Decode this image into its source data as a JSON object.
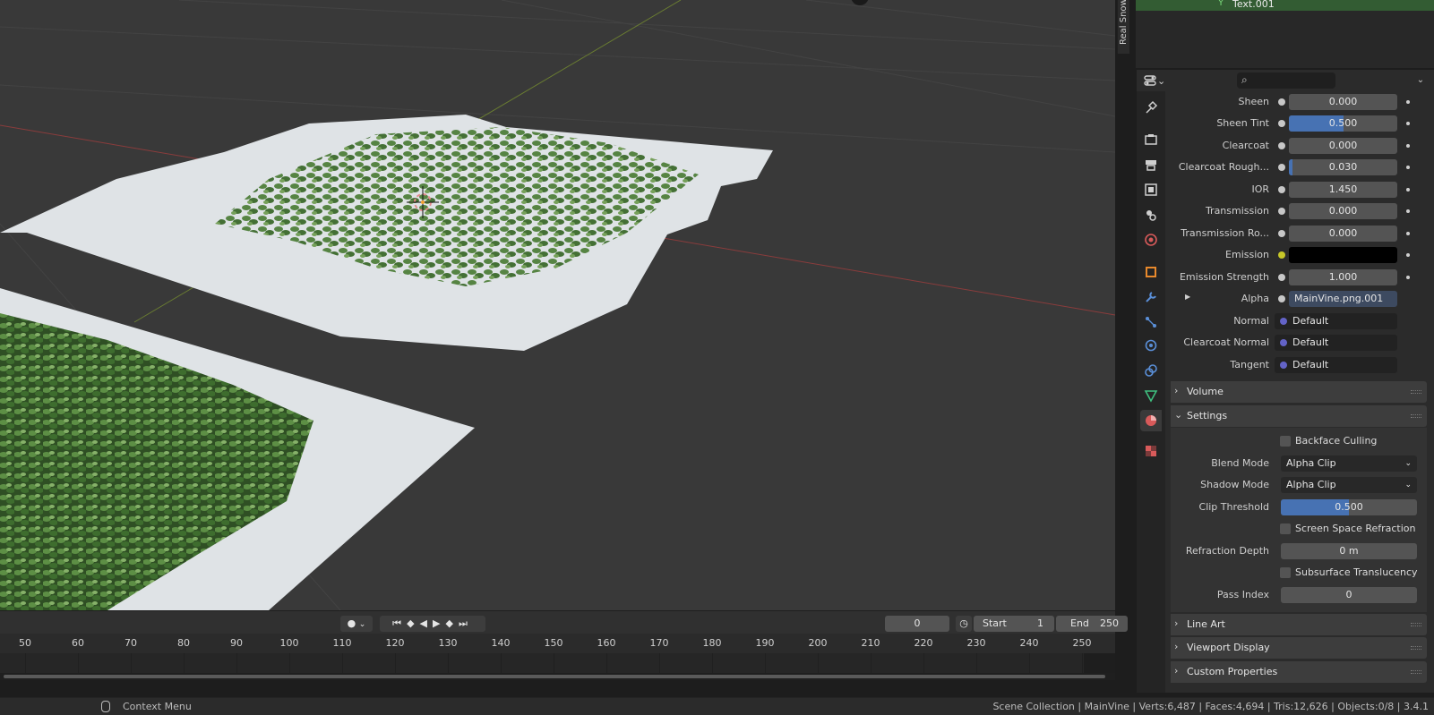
{
  "sidebar_tab": {
    "label": "Real Snow"
  },
  "outliner": {
    "selected_item": "Text.001"
  },
  "properties": {
    "search": {
      "placeholder": ""
    },
    "rows": [
      {
        "label": "Sheen",
        "value": "0.000",
        "fill": 0.0
      },
      {
        "label": "Sheen Tint",
        "value": "0.500",
        "fill": 0.5
      },
      {
        "label": "Clearcoat",
        "value": "0.000",
        "fill": 0.0
      },
      {
        "label": "Clearcoat Rough...",
        "value": "0.030",
        "fill": 0.03
      },
      {
        "label": "IOR",
        "value": "1.450"
      },
      {
        "label": "Transmission",
        "value": "0.000",
        "fill": 0.0
      },
      {
        "label": "Transmission Ro...",
        "value": "0.000",
        "fill": 0.0
      },
      {
        "label": "Emission",
        "value": "",
        "color": "#000000"
      },
      {
        "label": "Emission Strength",
        "value": "1.000"
      },
      {
        "label": "Alpha",
        "value": "MainVine.png.001"
      },
      {
        "label": "Normal",
        "value": "Default"
      },
      {
        "label": "Clearcoat Normal",
        "value": "Default"
      },
      {
        "label": "Tangent",
        "value": "Default"
      }
    ],
    "panels": {
      "volume": "Volume",
      "settings": "Settings",
      "line_art": "Line Art",
      "viewport_display": "Viewport Display",
      "custom_properties": "Custom Properties"
    },
    "settings": {
      "backface_culling": "Backface Culling",
      "blend_mode_label": "Blend Mode",
      "blend_mode_value": "Alpha Clip",
      "shadow_mode_label": "Shadow Mode",
      "shadow_mode_value": "Alpha Clip",
      "clip_threshold_label": "Clip Threshold",
      "clip_threshold_value": "0.500",
      "clip_threshold_fill": 0.5,
      "screen_space_refraction": "Screen Space Refraction",
      "refraction_depth_label": "Refraction Depth",
      "refraction_depth_value": "0 m",
      "subsurface_translucency": "Subsurface Translucency",
      "pass_index_label": "Pass Index",
      "pass_index_value": "0"
    }
  },
  "timeline": {
    "current_frame": "0",
    "start_label": "Start",
    "start_value": "1",
    "end_label": "End",
    "end_value": "250",
    "ticks": [
      "50",
      "60",
      "70",
      "80",
      "90",
      "100",
      "110",
      "120",
      "130",
      "140",
      "150",
      "160",
      "170",
      "180",
      "190",
      "200",
      "210",
      "220",
      "230",
      "240",
      "250"
    ]
  },
  "statusbar": {
    "context_menu": "Context Menu",
    "stats": "Scene Collection | MainVine | Verts:6,487 | Faces:4,694 | Tris:12,626 | Objects:0/8 | 3.4.1"
  },
  "colors": {
    "accent": "#4772b3",
    "selected_row": "#335c33",
    "viewport_bg": "#393939"
  }
}
